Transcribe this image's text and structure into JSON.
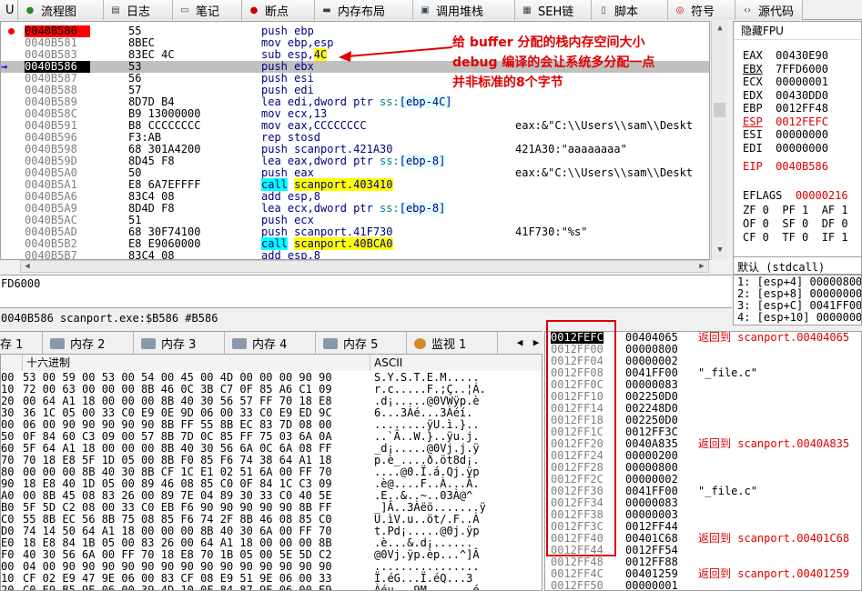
{
  "tabs": [
    {
      "label": "U",
      "icon": "cpu-icon"
    },
    {
      "label": "流程图",
      "icon": "graph-icon"
    },
    {
      "label": "日志",
      "icon": "log-icon"
    },
    {
      "label": "笔记",
      "icon": "notes-icon"
    },
    {
      "label": "断点",
      "icon": "breakpoint-icon"
    },
    {
      "label": "内存布局",
      "icon": "memory-map-icon"
    },
    {
      "label": "调用堆栈",
      "icon": "call-stack-icon"
    },
    {
      "label": "SEH链",
      "icon": "seh-icon"
    },
    {
      "label": "脚本",
      "icon": "script-icon"
    },
    {
      "label": "符号",
      "icon": "symbols-icon"
    },
    {
      "label": "源代码",
      "icon": "source-icon"
    }
  ],
  "disasm": [
    {
      "addr": "0040B580",
      "bytes": "55",
      "ins": "push ebp",
      "cmt": "",
      "state": "bp"
    },
    {
      "addr": "0040B581",
      "bytes": "8BEC",
      "ins": "mov ebp,esp",
      "cmt": ""
    },
    {
      "addr": "0040B583",
      "bytes": "83EC 4C",
      "ins": "sub esp,4C",
      "cmt": "",
      "hl": "4C"
    },
    {
      "addr": "0040B586",
      "bytes": "53",
      "ins": "push ebx",
      "cmt": "",
      "state": "cur"
    },
    {
      "addr": "0040B587",
      "bytes": "56",
      "ins": "push esi",
      "cmt": ""
    },
    {
      "addr": "0040B588",
      "bytes": "57",
      "ins": "push edi",
      "cmt": ""
    },
    {
      "addr": "0040B589",
      "bytes": "8D7D B4",
      "ins": "lea edi,dword ptr ss:[ebp-4C]",
      "cmt": ""
    },
    {
      "addr": "0040B58C",
      "bytes": "B9 13000000",
      "ins": "mov ecx,13",
      "cmt": ""
    },
    {
      "addr": "0040B591",
      "bytes": "B8 CCCCCCCC",
      "ins": "mov eax,CCCCCCCC",
      "cmt": "eax:&\"C:\\\\Users\\\\sam\\\\Deskt"
    },
    {
      "addr": "0040B596",
      "bytes": "F3:AB",
      "ins": "rep stosd",
      "cmt": ""
    },
    {
      "addr": "0040B598",
      "bytes": "68 301A4200",
      "ins": "push scanport.421A30",
      "cmt": "421A30:\"aaaaaaaa\""
    },
    {
      "addr": "0040B59D",
      "bytes": "8D45 F8",
      "ins": "lea eax,dword ptr ss:[ebp-8]",
      "cmt": ""
    },
    {
      "addr": "0040B5A0",
      "bytes": "50",
      "ins": "push eax",
      "cmt": "eax:&\"C:\\\\Users\\\\sam\\\\Deskt"
    },
    {
      "addr": "0040B5A1",
      "bytes": "E8 6A7EFFFF",
      "ins": "call scanport.403410",
      "cmt": "",
      "call": true
    },
    {
      "addr": "0040B5A6",
      "bytes": "83C4 08",
      "ins": "add esp,8",
      "cmt": ""
    },
    {
      "addr": "0040B5A9",
      "bytes": "8D4D F8",
      "ins": "lea ecx,dword ptr ss:[ebp-8]",
      "cmt": ""
    },
    {
      "addr": "0040B5AC",
      "bytes": "51",
      "ins": "push ecx",
      "cmt": ""
    },
    {
      "addr": "0040B5AD",
      "bytes": "68 30F74100",
      "ins": "push scanport.41F730",
      "cmt": "41F730:\"%s\""
    },
    {
      "addr": "0040B5B2",
      "bytes": "E8 E9060000",
      "ins": "call scanport.40BCA0",
      "cmt": "",
      "call": true
    },
    {
      "addr": "0040B5B7",
      "bytes": "83C4 08",
      "ins": "add esp,8",
      "cmt": ""
    }
  ],
  "annotation": [
    "给 buffer 分配的栈内存空间大小",
    "debug 编译的会让系统多分配一点",
    "并非标准的8个字节"
  ],
  "regs": {
    "title": "隐藏FPU",
    "lines": [
      {
        "n": "EAX",
        "v": "00430E90"
      },
      {
        "n": "EBX",
        "v": "7FFD6000"
      },
      {
        "n": "ECX",
        "v": "00000001"
      },
      {
        "n": "EDX",
        "v": "00430DD0"
      },
      {
        "n": "EBP",
        "v": "0012FF48"
      },
      {
        "n": "ESP",
        "v": "0012FEFC",
        "red": true
      },
      {
        "n": "ESI",
        "v": "00000000"
      },
      {
        "n": "EDI",
        "v": "00000000"
      },
      {
        "n": "EIP",
        "v": "0040B586",
        "red": true
      }
    ],
    "eflags_label": "EFLAGS",
    "eflags_val": "00000216",
    "flags": [
      "ZF 0  PF 1  AF 1",
      "OF 0  SF 0  DF 0",
      "CF 0  TF 0  IF 1"
    ]
  },
  "callconv": "默认 (stdcall)",
  "stackargs": [
    "1: [esp+4] 00000800",
    "2: [esp+8] 00000000",
    "3: [esp+C] 0041FF00",
    "4: [esp+10] 00000000"
  ],
  "info1": "FD6000",
  "info2": "0040B586 scanport.exe:$B586 #B586",
  "dumptabs": [
    "存 1",
    "内存 2",
    "内存 3",
    "内存 4",
    "内存 5",
    "监视 1"
  ],
  "dump_headers": {
    "hex": "十六进制",
    "ascii": "ASCII"
  },
  "dump": [
    {
      "a": "00",
      "h": "53 00 59 00 53 00 54 00 45 00 4D 00 00 00 90 90",
      "s": "S.Y.S.T.E.M....."
    },
    {
      "a": "10",
      "h": "72 00 63 00 00 00 8B 46 0C 3B C7 0F 85 A6 C1 09",
      "s": "r.c.....F.;Ç..¦Á."
    },
    {
      "a": "20",
      "h": "00 64 A1 18 00 00 00 8B 40 30 56 57 FF 70 18 E8",
      "s": ".d¡.....@0VWÿp.è"
    },
    {
      "a": "30",
      "h": "36 1C 05 00 33 C0 E9 0E 9D 06 00 33 C0 E9 ED 9C",
      "s": "6...3Àé...3Àéí."
    },
    {
      "a": "00",
      "h": "06 00 90 90 90 90 90 8B FF 55 8B EC 83 7D 08 00",
      "s": "........ÿU.ì.}.."
    },
    {
      "a": "50",
      "h": "0F 84 60 C3 09 00 57 8B 7D 0C 85 FF 75 03 6A 0A",
      "s": "..`Ã..W.}..ÿu.j."
    },
    {
      "a": "60",
      "h": "5F 64 A1 18 00 00 00 8B 40 30 56 6A 0C 6A 08 FF",
      "s": "_d¡.....@0Vj.j.ÿ"
    },
    {
      "a": "70",
      "h": "70 18 E8 5F 1D 05 00 8B F0 85 F6 74 38 64 A1 18",
      "s": "p.è_....ð.öt8d¡."
    },
    {
      "a": "80",
      "h": "00 00 00 8B 40 30 8B CF 1C E1 02 51 6A 00 FF 70",
      "s": "....@0.Ï.á.Qj.ÿp"
    },
    {
      "a": "90",
      "h": "18 E8 40 1D 05 00 89 46 08 85 C0 0F 84 1C C3 09",
      "s": ".è@....F..À...Ã."
    },
    {
      "a": "A0",
      "h": "00 8B 45 08 83 26 00 89 7E 04 89 30 33 C0 40 5E",
      "s": ".E..&..~..03À@^"
    },
    {
      "a": "B0",
      "h": "5F 5D C2 08 00 33 C0 EB F6 90 90 90 90 90 8B FF",
      "s": "_]Â..3Àëö.......ÿ"
    },
    {
      "a": "C0",
      "h": "55 8B EC 56 8B 75 08 85 F6 74 2F 8B 46 08 85 C0",
      "s": "U.ìV.u..öt/.F..À"
    },
    {
      "a": "D0",
      "h": "74 14 50 64 A1 18 00 00 00 8B 40 30 6A 00 FF 70",
      "s": "t.Pd¡.....@0j.ÿp"
    },
    {
      "a": "E0",
      "h": "18 E8 84 1B 05 00 83 26 00 64 A1 18 00 00 00 8B",
      "s": ".è...&.d¡......"
    },
    {
      "a": "F0",
      "h": "40 30 56 6A 00 FF 70 18 E8 70 1B 05 00 5E 5D C2",
      "s": "@0Vj.ÿp.èp...^]Â"
    },
    {
      "a": "00",
      "h": "04 00 90 90 90 90 90 90 90 90 90 90 90 90 90 90",
      "s": "................"
    },
    {
      "a": "10",
      "h": "CF 02 E9 47 9E 06 00 83 CF 08 E9 51 9E 06 00 33",
      "s": "Ï.éG...Ï.éQ...3"
    },
    {
      "a": "20",
      "h": "C0 E9 B5 9E 06 00 39 4D 10 0F 84 87 9E 06 00 E9",
      "s": "Àéµ...9M.......é"
    },
    {
      "a": "30",
      "h": "F1 C4 09 00 50 E8 38 2B 05 00 5E E8 7A C2 09 00",
      "s": "ñÄ..Pè8+..^èzÂ.."
    }
  ],
  "stack": [
    {
      "a": "0012FEFC",
      "v": "00404065",
      "c": "返回到 scanport.00404065",
      "top": true
    },
    {
      "a": "0012FF00",
      "v": "00000800",
      "c": ""
    },
    {
      "a": "0012FF04",
      "v": "00000002",
      "c": ""
    },
    {
      "a": "0012FF08",
      "v": "0041FF00",
      "c": "\"_file.c\""
    },
    {
      "a": "0012FF0C",
      "v": "00000083",
      "c": ""
    },
    {
      "a": "0012FF10",
      "v": "002250D0",
      "c": ""
    },
    {
      "a": "0012FF14",
      "v": "002248D0",
      "c": ""
    },
    {
      "a": "0012FF18",
      "v": "002250D0",
      "c": ""
    },
    {
      "a": "0012FF1C",
      "v": "0012FF3C",
      "c": ""
    },
    {
      "a": "0012FF20",
      "v": "0040A835",
      "c": "返回到 scanport.0040A835"
    },
    {
      "a": "0012FF24",
      "v": "00000200",
      "c": ""
    },
    {
      "a": "0012FF28",
      "v": "00000800",
      "c": ""
    },
    {
      "a": "0012FF2C",
      "v": "00000002",
      "c": ""
    },
    {
      "a": "0012FF30",
      "v": "0041FF00",
      "c": "\"_file.c\""
    },
    {
      "a": "0012FF34",
      "v": "00000083",
      "c": ""
    },
    {
      "a": "0012FF38",
      "v": "00000003",
      "c": ""
    },
    {
      "a": "0012FF3C",
      "v": "0012FF44",
      "c": ""
    },
    {
      "a": "0012FF40",
      "v": "00401C68",
      "c": "返回到 scanport.00401C68"
    },
    {
      "a": "0012FF44",
      "v": "0012FF54",
      "c": ""
    },
    {
      "a": "0012FF48",
      "v": "0012FF88",
      "c": ""
    },
    {
      "a": "0012FF4C",
      "v": "00401259",
      "c": "返回到 scanport.00401259"
    },
    {
      "a": "0012FF50",
      "v": "00000001",
      "c": ""
    }
  ],
  "colors": {
    "breakpoint": "#ff0000",
    "annotation": "#e00000",
    "call_highlight": "#00ffff",
    "eip_marker": "#0000ff"
  }
}
